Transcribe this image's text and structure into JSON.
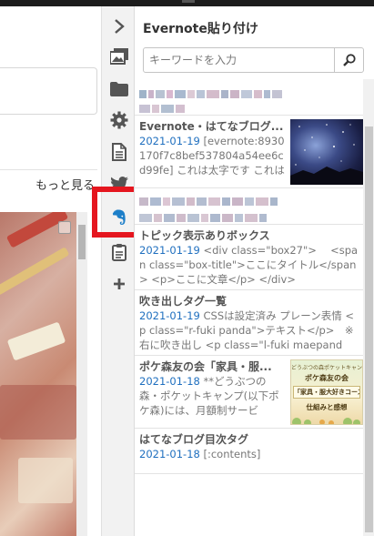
{
  "editor": {
    "more_label": "もっと見る"
  },
  "rail": {
    "icons": [
      "chevron-right-icon",
      "image-icon",
      "folder-icon",
      "gear-icon",
      "document-icon",
      "twitter-icon",
      "evernote-icon",
      "clipboard-icon",
      "plus-icon"
    ],
    "highlight_color": "#e5161f",
    "evernote_color": "#1d7fc9"
  },
  "panel": {
    "title": "Evernote貼り付け",
    "search": {
      "placeholder": "キーワードを入力",
      "value": ""
    },
    "notes": [
      {
        "redacted": true
      },
      {
        "title": "Evernote・はてなブログ...",
        "date": "2021-01-19",
        "excerpt": "[evernote:8930170f7c8bef537804a54ee6cd99fe] これは太字です これは",
        "thumbnail": "starry-night-image"
      },
      {
        "redacted": true
      },
      {
        "title": "トピック表示ありボックス",
        "date": "2021-01-19",
        "excerpt": "<div class=\"box27\">　 <span class=\"box-title\">ここにタイトル</span> <p>ここに文章</p> </div>"
      },
      {
        "title": "吹き出しタグ一覧",
        "date": "2021-01-19",
        "excerpt": "CSSは設定済み プレーン表情 <p class=\"r-fuki panda\">テキスト</p>　※右に吹き出し <p class=\"l-fuki maepanda\">テ"
      },
      {
        "title": "ポケ森友の会「家具・服...",
        "date": "2021-01-18",
        "excerpt": "**どうぶつの森・ポケットキャンプ(以下ポケ森)には、月額制サービ",
        "thumbnail": "pokemori-banner-image",
        "thumbnail_text": [
          "どうぶつの森ポケットキャンプ",
          "ポケ森友の会",
          "「家具・服大好きコース」の",
          "仕組みと感想"
        ]
      },
      {
        "title": "はてなブログ目次タグ",
        "date": "2021-01-18",
        "excerpt": "[:contents]"
      }
    ]
  }
}
